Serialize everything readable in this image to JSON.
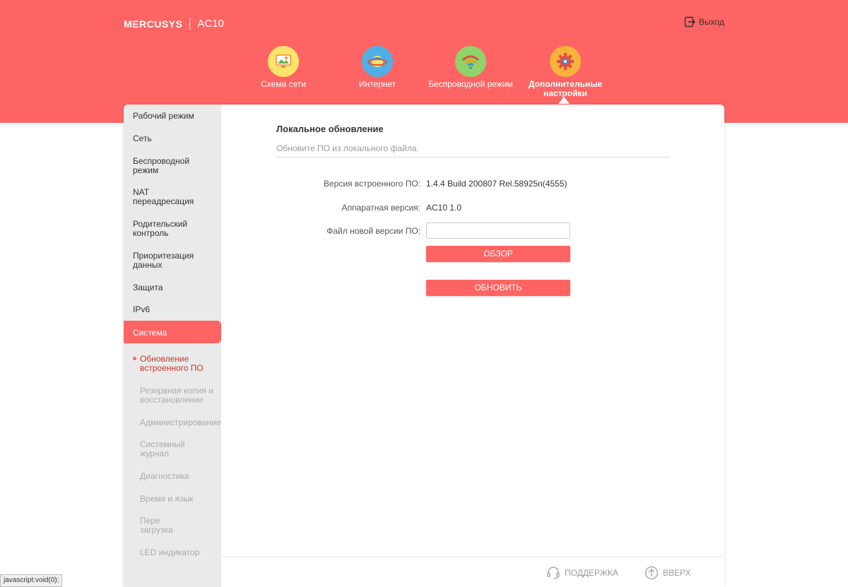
{
  "header": {
    "brand": "MERCUSYS",
    "model": "AC10",
    "logout_label": "Выход"
  },
  "nav": {
    "items": [
      {
        "label": "Схема сети",
        "icon": "network-map-icon"
      },
      {
        "label": "Интернет",
        "icon": "globe-icon"
      },
      {
        "label": "Беспроводной режим",
        "icon": "wifi-icon"
      },
      {
        "label": "Дополнительные настройки",
        "icon": "gear-icon"
      }
    ],
    "active_index": 3
  },
  "sidebar": {
    "items": [
      {
        "label": "Рабочий режим"
      },
      {
        "label": "Сеть"
      },
      {
        "label": "Беспроводной режим"
      },
      {
        "label": "NAT переадресация"
      },
      {
        "label": "Родительский контроль"
      },
      {
        "label": "Приоритезация данных"
      },
      {
        "label": "Защита"
      },
      {
        "label": "IPv6"
      },
      {
        "label": "Система"
      }
    ],
    "active_label": "Система",
    "sub_items": [
      {
        "label": "Обновление встроенного ПО"
      },
      {
        "label": "Резервная копия и восстановление"
      },
      {
        "label": "Администрирование"
      },
      {
        "label": "Системный журнал"
      },
      {
        "label": "Диагностика"
      },
      {
        "label": "Время и язык"
      },
      {
        "label": "Пере загрузка"
      },
      {
        "label": "LED индикатор"
      }
    ]
  },
  "content": {
    "title": "Локальное обновление",
    "description": "Обновите ПО из локального файла.",
    "firmware_label": "Версия встроенного ПО:",
    "firmware_value": "1.4.4 Build 200807 Rel.58925n(4555)",
    "hardware_label": "Аппаратная версия:",
    "hardware_value": "AC10 1.0",
    "file_label": "Файл новой версии ПО:",
    "file_value": "",
    "browse_button": "ОБЗОР",
    "update_button": "ОБНОВИТЬ"
  },
  "footer": {
    "support_label": "ПОДДЕРЖКА",
    "top_label": "ВВЕРХ"
  },
  "statusbar": {
    "text": "javascript:void(0);"
  },
  "colors": {
    "accent": "#fe6463",
    "sidebar_bg": "#eaeaea"
  }
}
